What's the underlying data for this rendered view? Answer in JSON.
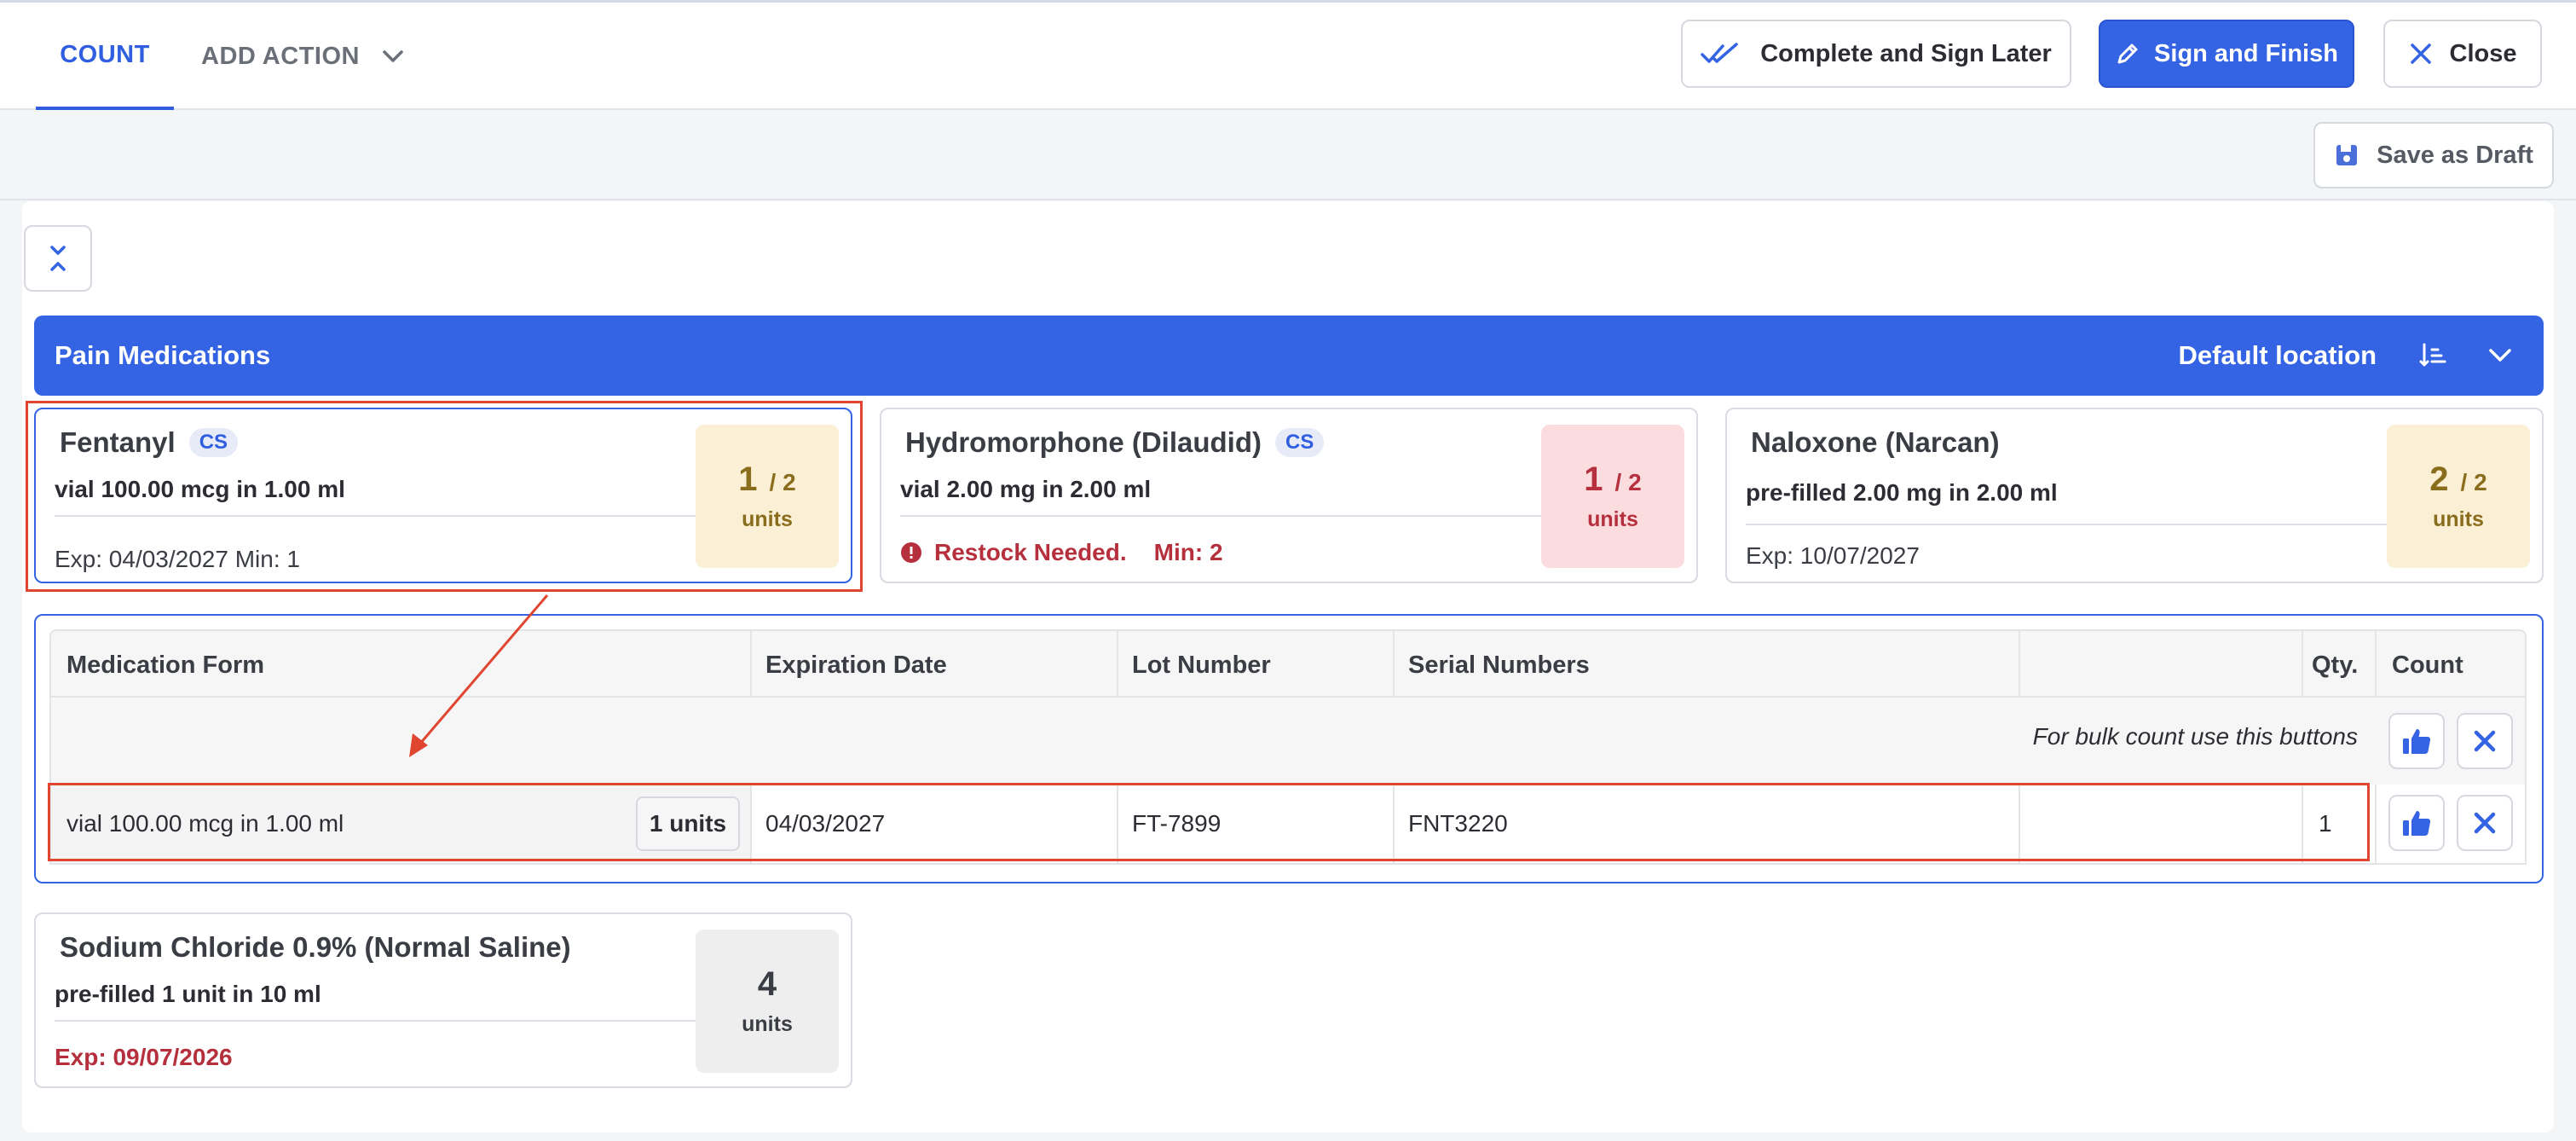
{
  "tabs": {
    "count": "COUNT",
    "add_action": "ADD ACTION"
  },
  "toolbar": {
    "complete_later": "Complete and Sign Later",
    "sign_finish": "Sign and Finish",
    "close": "Close",
    "save_draft": "Save as Draft"
  },
  "section": {
    "title": "Pain Medications",
    "location": "Default location"
  },
  "cards": [
    {
      "name": "Fentanyl",
      "badge": "CS",
      "form": "vial 100.00 mcg in 1.00 ml",
      "footer": "Exp: 04/03/2027 Min: 1",
      "count": "1",
      "total": "/ 2",
      "units": "units"
    },
    {
      "name": "Hydromorphone (Dilaudid)",
      "badge": "CS",
      "form": "vial 2.00 mg in 2.00 ml",
      "restock": "Restock Needed.",
      "min": "Min: 2",
      "count": "1",
      "total": "/ 2",
      "units": "units"
    },
    {
      "name": "Naloxone (Narcan)",
      "form": "pre-filled 2.00 mg in 2.00 ml",
      "footer": "Exp: 10/07/2027",
      "count": "2",
      "total": "/ 2",
      "units": "units"
    },
    {
      "name": "Sodium Chloride 0.9% (Normal Saline)",
      "form": "pre-filled 1 unit in 10 ml",
      "footer": "Exp: 09/07/2026",
      "count": "4",
      "units": "units"
    }
  ],
  "table": {
    "headers": {
      "form": "Medication Form",
      "expiration": "Expiration Date",
      "lot": "Lot Number",
      "serial": "Serial Numbers",
      "qty": "Qty.",
      "count": "Count"
    },
    "bulk_hint": "For bulk count use this buttons",
    "rows": [
      {
        "form": "vial 100.00 mcg in 1.00 ml",
        "units": "1 units",
        "expiration": "04/03/2027",
        "lot": "FT-7899",
        "serial": "FNT3220",
        "qty": "1"
      }
    ]
  },
  "colors": {
    "primary": "#3463e3",
    "amber_bg": "#fbefd6",
    "pink_bg": "#fbdde0",
    "alert_red": "#b5303c",
    "annotation_red": "#e0452f"
  }
}
